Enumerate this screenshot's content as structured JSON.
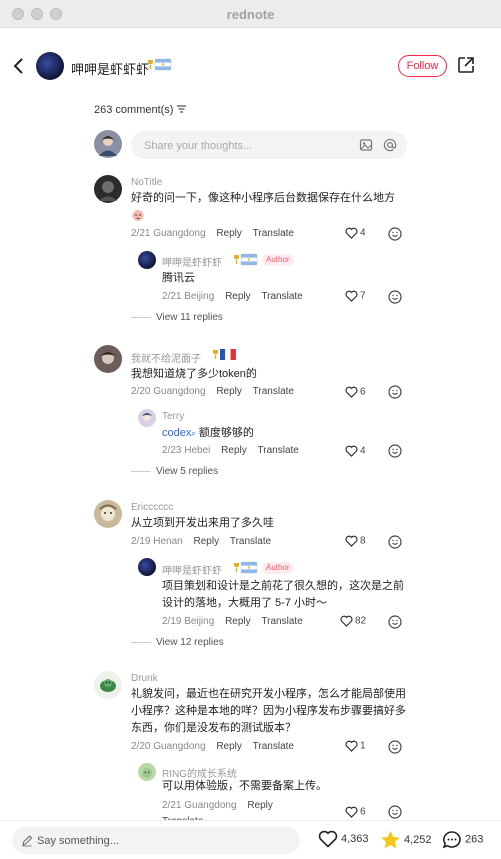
{
  "window": {
    "title": "rednote"
  },
  "header": {
    "author_name": "呷呷是虾虾虾",
    "follow_label": "Follow"
  },
  "comments_header": {
    "count_label": "263 comment(s)",
    "sort_icon": "filter-icon"
  },
  "composer": {
    "placeholder": "Share your thoughts..."
  },
  "actions": {
    "reply": "Reply",
    "translate": "Translate",
    "author_tag": "Author"
  },
  "comments": [
    {
      "user": "NoTitle",
      "text": "好奇的问一下，像这种小程序后台数据保存在什么地方",
      "date": "2/21",
      "location": "Guangdong",
      "likes": "4",
      "reply": {
        "user": "呷呷是虾虾虾",
        "text": "腾讯云",
        "date": "2/21",
        "location": "Beijing",
        "likes": "7"
      },
      "view_more": "View 11 replies"
    },
    {
      "user": "我就不给泥面子",
      "text": "我想知道烧了多少token的",
      "date": "2/20",
      "location": "Guangdong",
      "likes": "6",
      "reply": {
        "user": "Terry",
        "text_link": "codex",
        "text": " 额度够够的",
        "date": "2/23",
        "location": "Hebei",
        "likes": "4"
      },
      "view_more": "View 5 replies"
    },
    {
      "user": "Ericccccc",
      "text": "从立项到开发出来用了多久哇",
      "date": "2/19",
      "location": "Henan",
      "likes": "8",
      "reply": {
        "user": "呷呷是虾虾虾",
        "line1": "项目策划和设计是之前花了很久想的，这次是之前",
        "line2": "设计的落地，大概用了 5-7 小时～",
        "date": "2/19",
        "location": "Beijing",
        "likes": "82"
      },
      "view_more": "View 12 replies"
    },
    {
      "user": "Drunk",
      "line1": "礼貌发问，最近也在研究开发小程序，怎么才能局部使用",
      "line2": "小程序？这种是本地的咩？因为小程序发布步骤要搞好多",
      "line3": "东西，你们是没发布的测试版本？",
      "date": "2/20",
      "location": "Guangdong",
      "likes": "1",
      "reply": {
        "user": "RING的成长系统",
        "text": "可以用体验版，不需要备案上传。",
        "date": "2/21",
        "location": "Guangdong",
        "likes": "6"
      }
    }
  ],
  "bottom_bar": {
    "placeholder": "Say something...",
    "likes": "4,363",
    "collects": "4,252",
    "comments": "263"
  },
  "colors": {
    "brand": "#ff2442",
    "link": "#2e6bd6",
    "star": "#f5c518"
  }
}
